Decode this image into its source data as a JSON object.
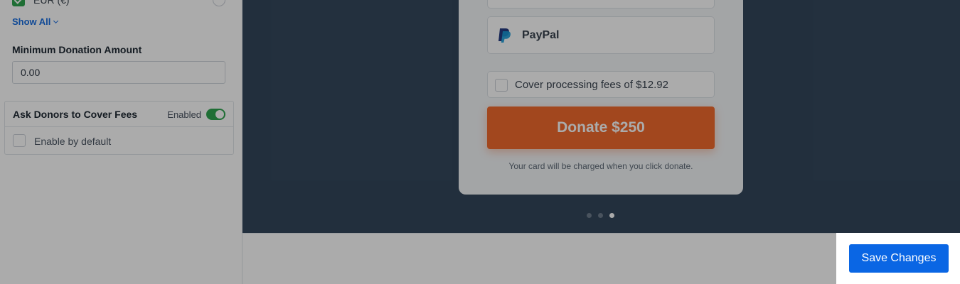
{
  "settings": {
    "currency_option": {
      "label": "EUR (€)",
      "checked": true
    },
    "show_all": "Show All",
    "min_donation": {
      "label": "Minimum Donation Amount",
      "value": "0.00"
    },
    "cover_fees": {
      "title": "Ask Donors to Cover Fees",
      "status": "Enabled",
      "enabled": true,
      "default_label": "Enable by default",
      "default_checked": false
    }
  },
  "preview": {
    "paypal_label": "PayPal",
    "cover_fees_label": "Cover processing fees of $12.92",
    "donate_button": "Donate $250",
    "charge_note": "Your card will be charged when you click donate.",
    "pagination": {
      "total": 3,
      "active": 3
    }
  },
  "footer": {
    "save_button": "Save Changes"
  },
  "colors": {
    "accent_blue": "#0a66e4",
    "donate_orange": "#f26b2d",
    "toggle_green": "#2fa44f",
    "preview_bg": "#34475c"
  },
  "icons": [
    "chevron-down-icon",
    "paypal-icon",
    "checkbox-check-icon"
  ]
}
